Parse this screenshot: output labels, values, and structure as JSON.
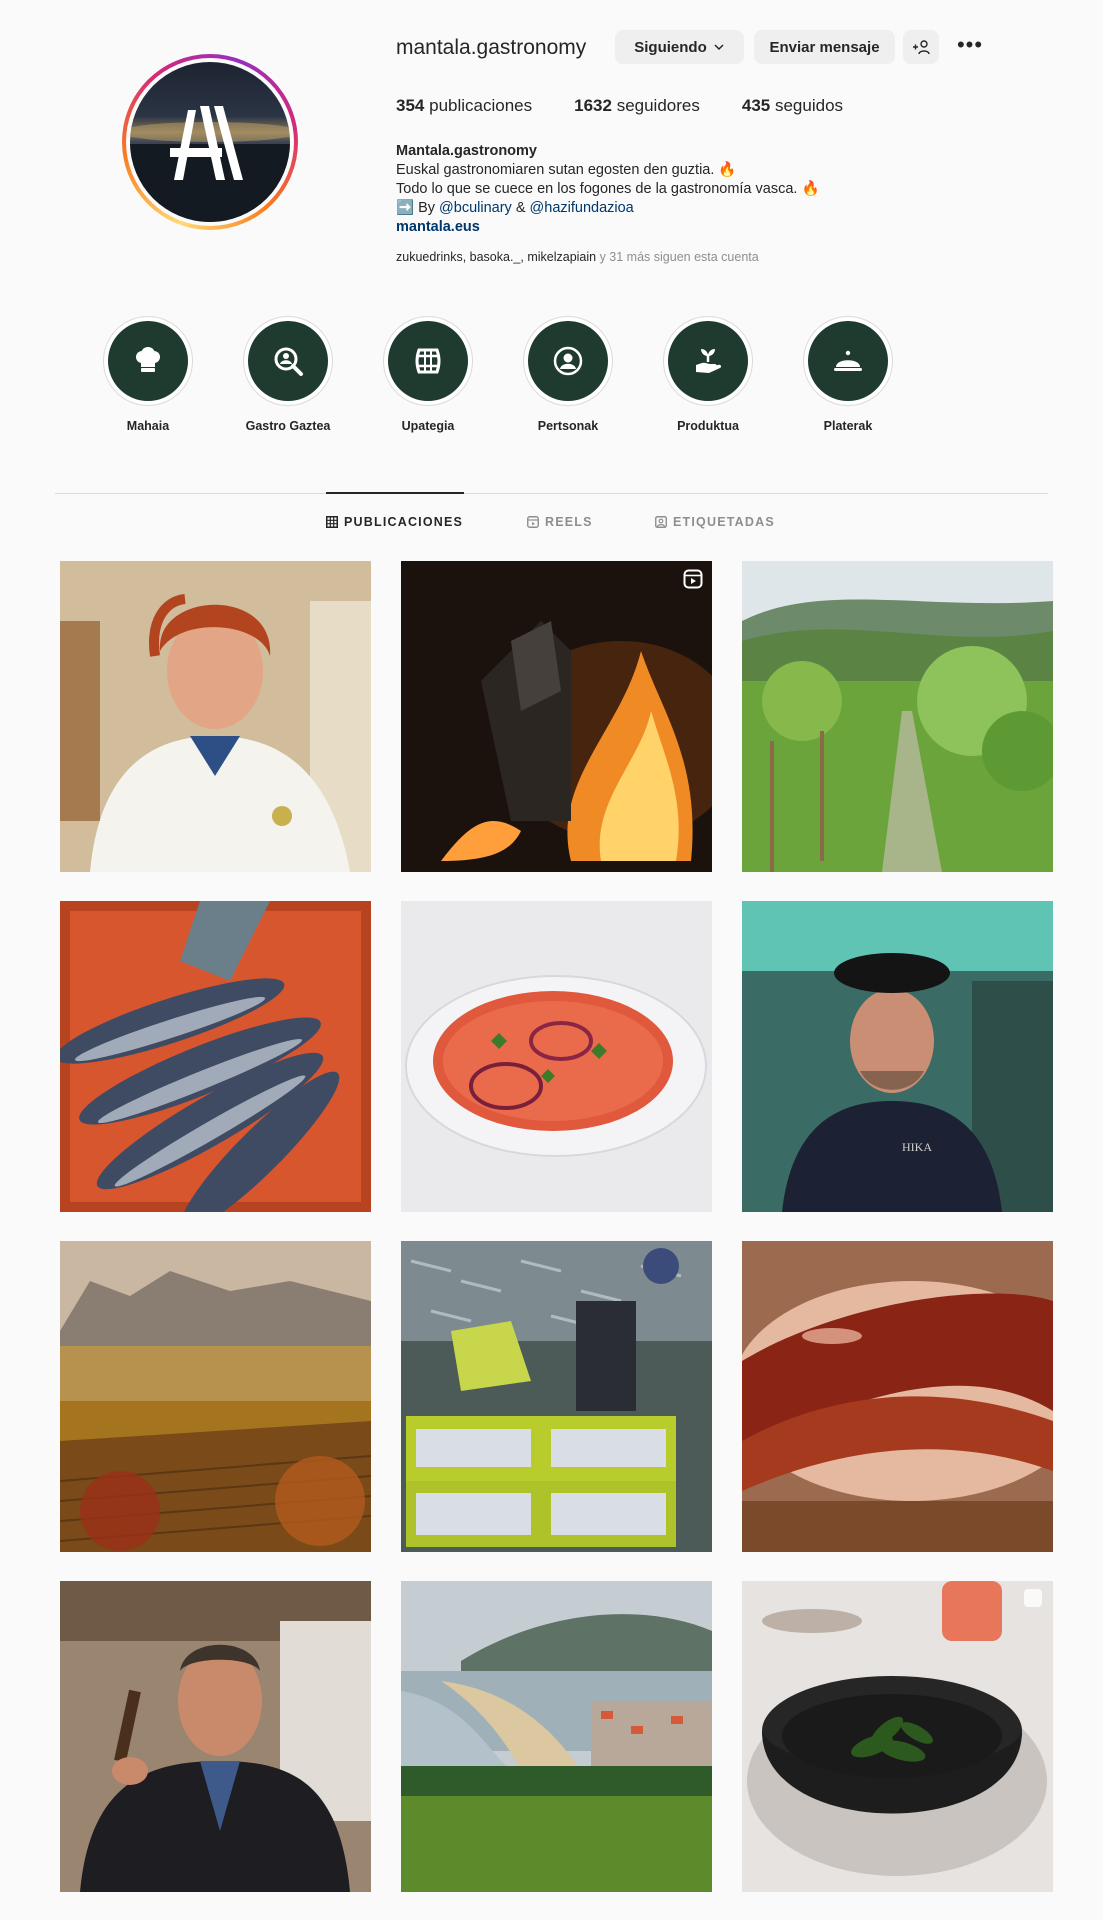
{
  "profile": {
    "username": "mantala.gastronomy",
    "following_label": "Siguiendo",
    "message_label": "Enviar mensaje",
    "suggest_icon": "add-person-icon",
    "more_icon": "more-icon",
    "stats": {
      "posts_count": "354",
      "posts_label": "publicaciones",
      "followers_count": "1632",
      "followers_label": "seguidores",
      "following_count": "435",
      "following_label": "seguidos"
    },
    "bio": {
      "display_name": "Mantala.gastronomy",
      "line1": "Euskal gastronomiaren sutan egosten den guztia. 🔥",
      "line2": "Todo lo que se cuece en los fogones de la gastronomía vasca. 🔥",
      "line3_prefix": "➡️ By ",
      "mention1": "@bculinary",
      "line3_amp": " & ",
      "mention2": "@hazifundazioa",
      "link": "mantala.eus"
    },
    "followed_by": {
      "names": "zukuedrinks, basoka._, mikelzapiain",
      "more": " y 31 más siguen esta cuenta"
    }
  },
  "highlights": [
    {
      "label": "Mahaia",
      "icon": "chef-hat-icon"
    },
    {
      "label": "Gastro Gaztea",
      "icon": "search-person-icon"
    },
    {
      "label": "Upategia",
      "icon": "barrel-icon"
    },
    {
      "label": "Pertsonak",
      "icon": "person-icon"
    },
    {
      "label": "Produktua",
      "icon": "hand-plant-icon"
    },
    {
      "label": "Platerak",
      "icon": "cloche-icon"
    }
  ],
  "tabs": [
    {
      "label": "PUBLICACIONES",
      "icon": "grid-icon",
      "active": true
    },
    {
      "label": "REELS",
      "icon": "reels-icon",
      "active": false
    },
    {
      "label": "ETIQUETADAS",
      "icon": "tagged-icon",
      "active": false
    }
  ],
  "posts": [
    {
      "subject": "chef-woman-portrait",
      "reel": false
    },
    {
      "subject": "wood-fire",
      "reel": true
    },
    {
      "subject": "green-valley-path",
      "reel": false
    },
    {
      "subject": "tuna-crate",
      "reel": false
    },
    {
      "subject": "tomato-salad",
      "reel": false
    },
    {
      "subject": "chef-beret-portrait",
      "reel": false
    },
    {
      "subject": "vineyard-mountains",
      "reel": false
    },
    {
      "subject": "fish-market-crates",
      "reel": false
    },
    {
      "subject": "glazed-meat",
      "reel": false
    },
    {
      "subject": "farmer-portrait",
      "reel": false
    },
    {
      "subject": "beach-town-coast",
      "reel": false
    },
    {
      "subject": "peppers-bowl",
      "reel": false
    }
  ],
  "colors": {
    "highlight_bg": "#1f3a2e",
    "link": "#00376b",
    "muted": "#8e8e8e"
  }
}
